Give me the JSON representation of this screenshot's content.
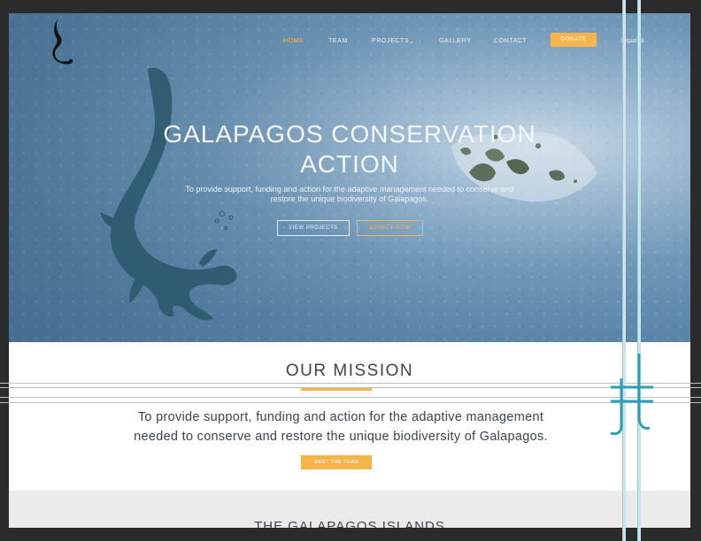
{
  "nav": {
    "items": [
      {
        "label": "HOME",
        "active": true
      },
      {
        "label": "TEAM",
        "active": false
      },
      {
        "label": "PROJECTS",
        "active": false
      },
      {
        "label": "GALLERY",
        "active": false
      },
      {
        "label": "CONTACT",
        "active": false
      }
    ],
    "projects_caret": "⌄",
    "donate_label": "DONATE",
    "language_label": "Español"
  },
  "hero": {
    "title_line1": "GALAPAGOS CONSERVATION",
    "title_line2": "ACTION",
    "subtitle_line1": "To provide support, funding and action for the adaptive management needed to conserve and",
    "subtitle_line2": "restore the unique biodiversity of Galapagos.",
    "view_projects_label": "VIEW PROJECTS",
    "donate_now_label": "DONATE NOW"
  },
  "mission": {
    "title": "OUR MISSION",
    "text_line1": "To provide support, funding and action for the adaptive management",
    "text_line2": "needed to conserve and restore the unique biodiversity of Galapagos.",
    "button_label": "MEET THE TEAM"
  },
  "islands": {
    "title": "THE GALAPAGOS ISLANDS"
  },
  "colors": {
    "accent": "#f6b54a",
    "text_dark": "#3a4450",
    "ocean": "#6f97b8",
    "overlay_teal": "#2a9fb8"
  },
  "icons": {
    "logo": "lizard-logo-icon",
    "hero_graphic": "iguana-silhouette-icon",
    "map_graphic": "galapagos-islands-icon",
    "overlay_mark": "crossed-lines-mark-icon"
  }
}
